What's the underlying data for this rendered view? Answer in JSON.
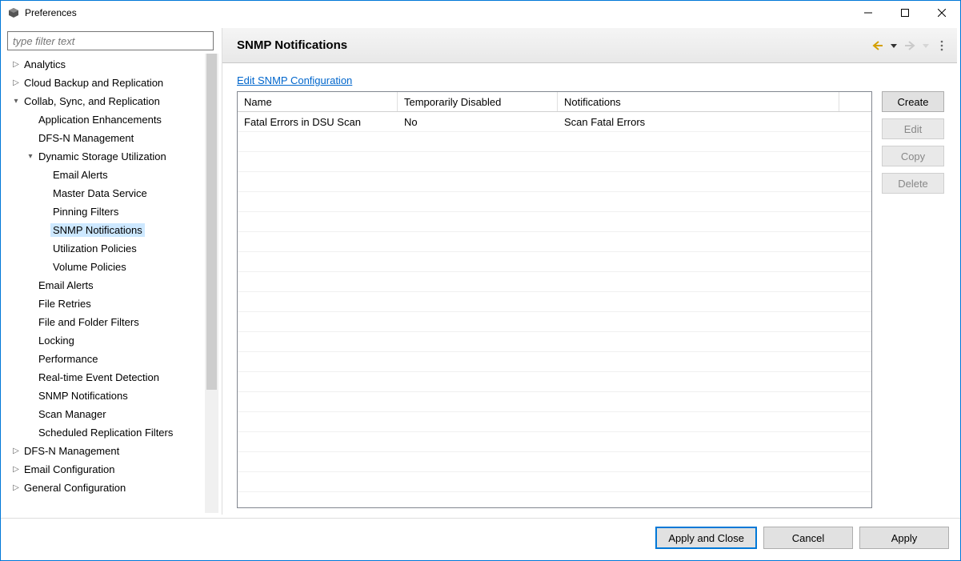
{
  "window": {
    "title": "Preferences"
  },
  "sidebar": {
    "filter_placeholder": "type filter text",
    "items": {
      "analytics": "Analytics",
      "cloud_backup": "Cloud Backup and Replication",
      "collab": "Collab, Sync, and Replication",
      "app_enh": "Application Enhancements",
      "dfsn_mgmt": "DFS-N Management",
      "dsu": "Dynamic Storage Utilization",
      "email_alerts_dsu": "Email Alerts",
      "master_data": "Master Data Service",
      "pinning": "Pinning Filters",
      "snmp_dsu": "SNMP Notifications",
      "util_policies": "Utilization Policies",
      "vol_policies": "Volume Policies",
      "email_alerts": "Email Alerts",
      "file_retries": "File Retries",
      "file_folder_filters": "File and Folder Filters",
      "locking": "Locking",
      "performance": "Performance",
      "realtime": "Real-time Event Detection",
      "snmp": "SNMP Notifications",
      "scan_mgr": "Scan Manager",
      "sched_repl": "Scheduled Replication Filters",
      "dfsn_mgmt2": "DFS-N Management",
      "email_config": "Email Configuration",
      "gen_config": "General Configuration"
    }
  },
  "content": {
    "title": "SNMP Notifications",
    "link": "Edit SNMP Configuration",
    "columns": {
      "name": "Name",
      "disabled": "Temporarily Disabled",
      "notifications": "Notifications"
    },
    "rows": [
      {
        "name": "Fatal Errors in DSU Scan",
        "disabled": "No",
        "notifications": "Scan Fatal Errors"
      }
    ],
    "buttons": {
      "create": "Create",
      "edit": "Edit",
      "copy": "Copy",
      "delete": "Delete"
    }
  },
  "footer": {
    "apply_close": "Apply and Close",
    "cancel": "Cancel",
    "apply": "Apply"
  }
}
